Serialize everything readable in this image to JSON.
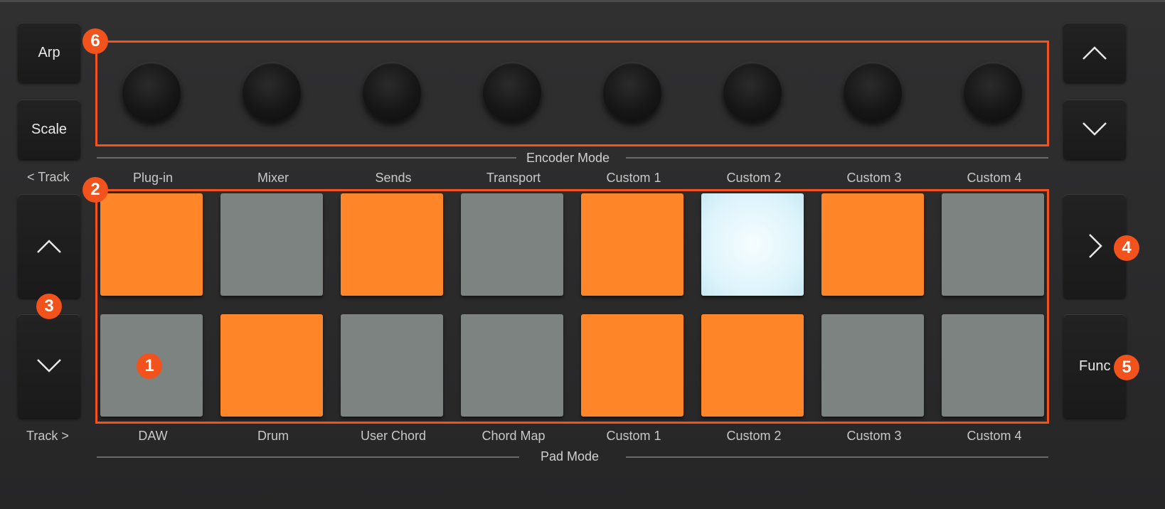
{
  "left_buttons": {
    "arp_label": "Arp",
    "scale_label": "Scale",
    "track_prev_label": "< Track",
    "track_next_label": "Track >"
  },
  "right_buttons": {
    "func_label": "Func"
  },
  "encoder_mode": {
    "title": "Encoder Mode",
    "labels": [
      "Plug-in",
      "Mixer",
      "Sends",
      "Transport",
      "Custom 1",
      "Custom 2",
      "Custom 3",
      "Custom 4"
    ]
  },
  "pad_mode": {
    "title": "Pad Mode",
    "labels": [
      "DAW",
      "Drum",
      "User Chord",
      "Chord Map",
      "Custom 1",
      "Custom 2",
      "Custom 3",
      "Custom 4"
    ]
  },
  "pads": {
    "top_row": [
      "orange",
      "grey",
      "orange",
      "grey",
      "orange",
      "white",
      "orange",
      "grey"
    ],
    "bottom_row": [
      "grey",
      "orange",
      "grey",
      "grey",
      "orange",
      "orange",
      "grey",
      "grey"
    ]
  },
  "callouts": {
    "c1": "1",
    "c2": "2",
    "c3": "3",
    "c4": "4",
    "c5": "5",
    "c6": "6"
  },
  "colors": {
    "accent": "#f2531c",
    "pad_orange": "#ff8529",
    "pad_grey": "#7c8381",
    "pad_white": "#dcf3fb"
  }
}
